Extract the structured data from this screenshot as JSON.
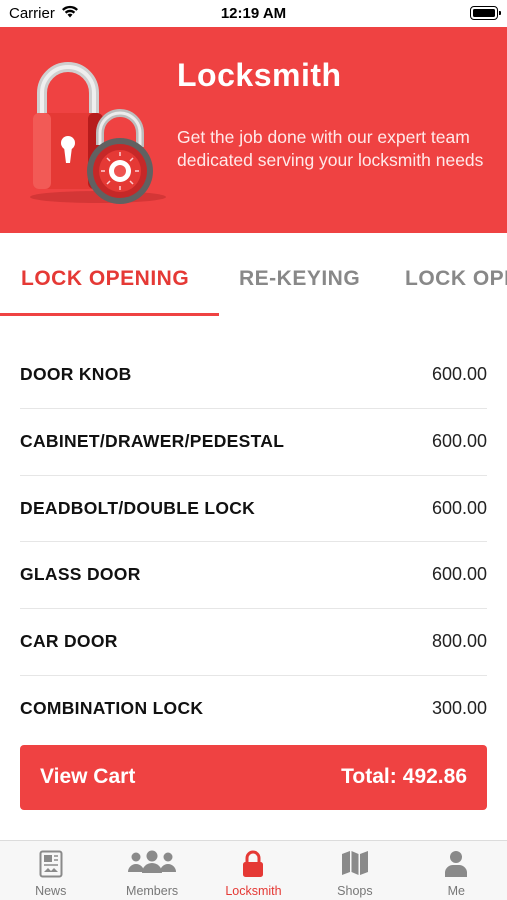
{
  "status_bar": {
    "carrier": "Carrier",
    "time": "12:19 AM"
  },
  "banner": {
    "title": "Locksmith",
    "description": "Get the job done with our expert team dedicated serving your locksmith needs"
  },
  "tabs": [
    {
      "label": "LOCK OPENING",
      "active": true
    },
    {
      "label": "RE-KEYING",
      "active": false
    },
    {
      "label": "LOCK OPENING",
      "active": false
    }
  ],
  "services": [
    {
      "name": "DOOR KNOB",
      "price": "600.00"
    },
    {
      "name": "CABINET/DRAWER/PEDESTAL",
      "price": "600.00"
    },
    {
      "name": "DEADBOLT/DOUBLE LOCK",
      "price": "600.00"
    },
    {
      "name": "GLASS DOOR",
      "price": "600.00"
    },
    {
      "name": "CAR DOOR",
      "price": "800.00"
    },
    {
      "name": "COMBINATION LOCK",
      "price": "300.00"
    }
  ],
  "cart": {
    "label": "View Cart",
    "total_label": "Total:",
    "total_value": "492.86"
  },
  "tabbar": [
    {
      "label": "News",
      "icon": "news-icon",
      "active": false
    },
    {
      "label": "Members",
      "icon": "members-icon",
      "active": false
    },
    {
      "label": "Locksmith",
      "icon": "lock-icon",
      "active": true
    },
    {
      "label": "Shops",
      "icon": "map-icon",
      "active": false
    },
    {
      "label": "Me",
      "icon": "person-icon",
      "active": false
    }
  ],
  "colors": {
    "accent": "#ef4242",
    "active_text": "#e53935",
    "inactive_tab": "#888888"
  }
}
